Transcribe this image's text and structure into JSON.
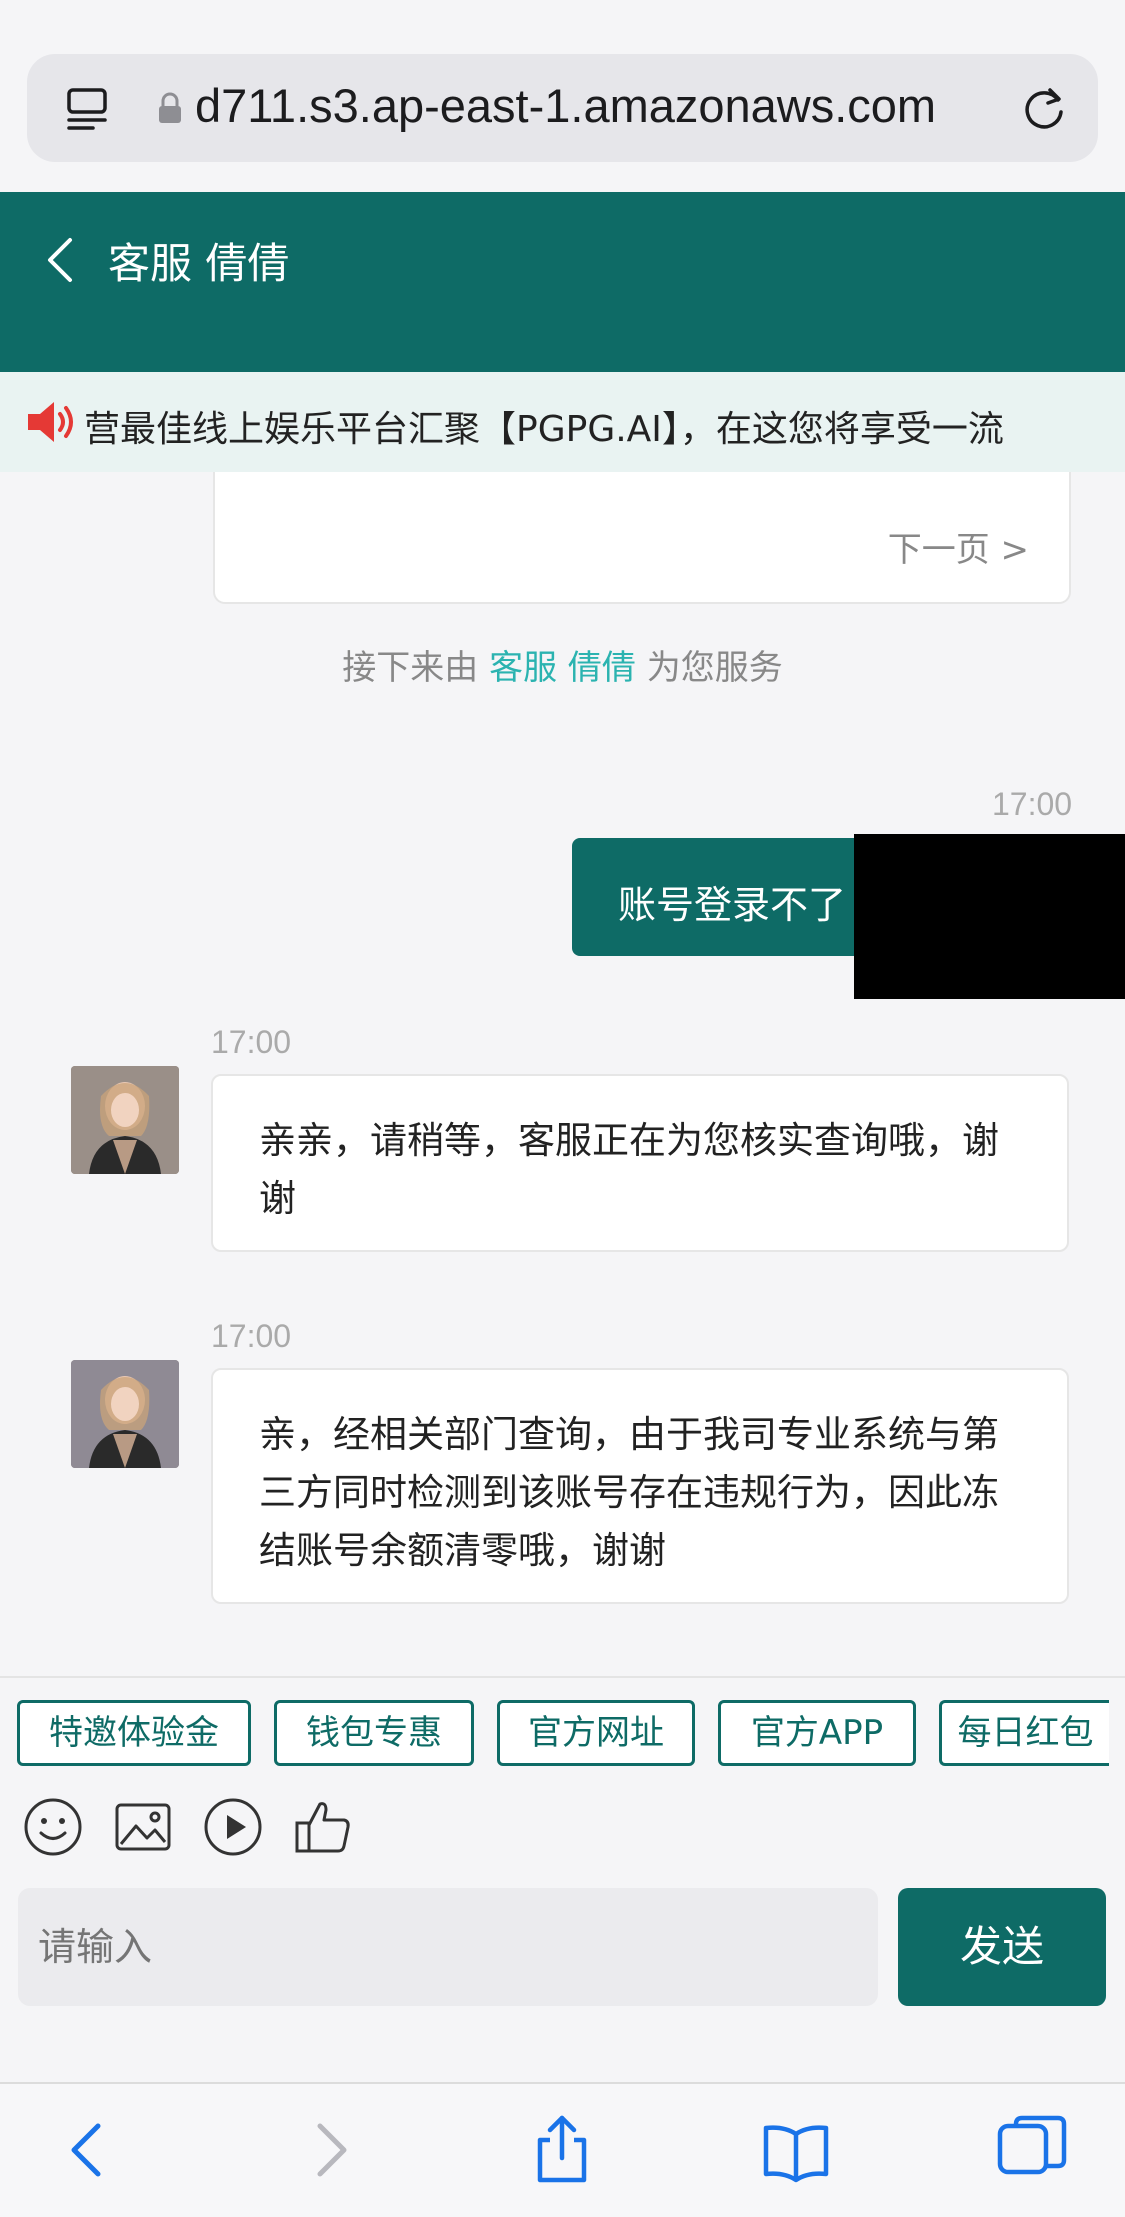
{
  "browser": {
    "url": "d711.s3.ap-east-1.amazonaws.com"
  },
  "header": {
    "back_icon": "chevron-left-icon",
    "title": "客服 倩倩"
  },
  "marquee": {
    "icon": "speaker-icon",
    "text": "营最佳线上娱乐平台汇聚【PGPG.AI】，在这您将享受一流"
  },
  "chat": {
    "previous_card": {
      "next_page": "下一页 >"
    },
    "notice": {
      "before": "接下来由 ",
      "agent": "客服 倩倩",
      "after": " 为您服务"
    },
    "messages": [
      {
        "from": "user",
        "time": "17:00",
        "text": "账号登录不了"
      },
      {
        "from": "agent",
        "time": "17:00",
        "text": "亲亲，请稍等，客服正在为您核实查询哦，谢谢"
      },
      {
        "from": "agent",
        "time": "17:00",
        "text": "亲，经相关部门查询，由于我司专业系统与第三方同时检测到该账号存在违规行为，因此冻结账号余额清零哦，谢谢"
      }
    ]
  },
  "quick_replies": [
    "特邀体验金",
    "钱包专惠",
    "官方网址",
    "官方APP",
    "每日红包"
  ],
  "composer": {
    "tools": [
      "smiley-icon",
      "image-icon",
      "play-icon",
      "thumbs-up-icon"
    ],
    "placeholder": "请输入",
    "send_label": "发送"
  },
  "colors": {
    "brand": "#0e6b66",
    "highlight": "#2bb3b0"
  }
}
